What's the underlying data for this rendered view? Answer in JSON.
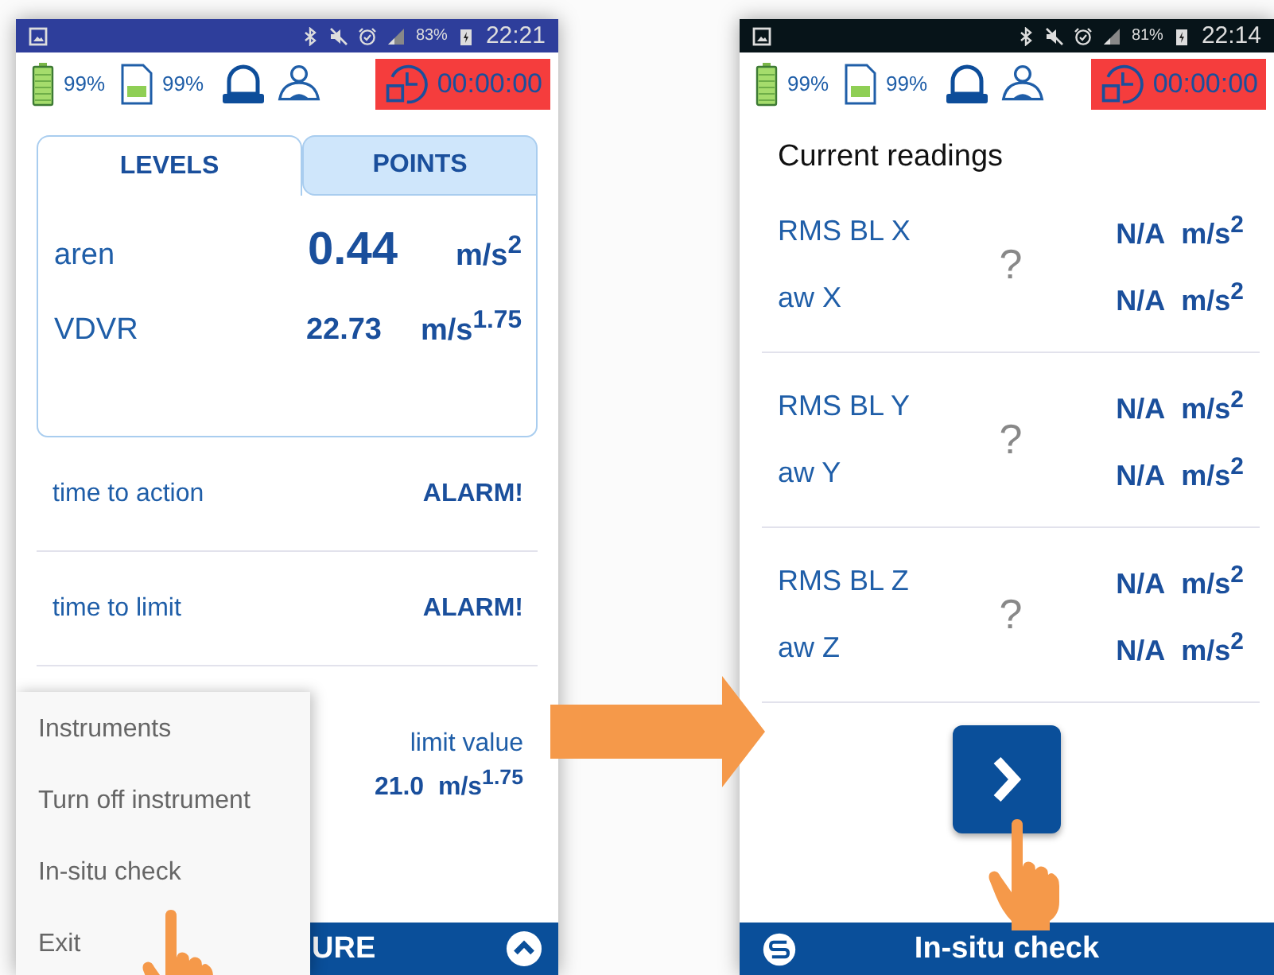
{
  "left_screen": {
    "status_bar": {
      "battery": "83%",
      "time": "22:21"
    },
    "indicators": {
      "battery": "99%",
      "sd_card": "99%",
      "timer": "00:00:00"
    },
    "tabs": [
      {
        "label": "LEVELS",
        "selected": true
      },
      {
        "label": "POINTS",
        "selected": false
      }
    ],
    "levels": [
      {
        "name": "aren",
        "value": "0.44",
        "unit": "m/s$^{2}$",
        "kind": "large"
      },
      {
        "name": "VDVR",
        "value": "22.73",
        "unit": "m/s$^{1.75}$",
        "kind": "normal"
      }
    ],
    "rows": [
      {
        "label": "time to action",
        "value": "ALARM!",
        "kind": "inline"
      },
      {
        "label": "time to limit",
        "value": "ALARM!",
        "kind": "inline"
      },
      {
        "label": "limit value",
        "value": "21.0  m/s$^{1.75}$",
        "kind": "stacked"
      }
    ],
    "menu": [
      "Instruments",
      "Turn off instrument",
      "In-situ check",
      "Exit"
    ],
    "bottom_bar": {
      "title": "URE"
    }
  },
  "right_screen": {
    "status_bar": {
      "battery": "81%",
      "time": "22:14"
    },
    "indicators": {
      "battery": "99%",
      "sd_card": "99%",
      "timer": "00:00:00"
    },
    "heading": "Current readings",
    "groups": [
      {
        "mark": "?",
        "readings": [
          {
            "label": "RMS BL X",
            "value": "N/A",
            "unit": "m/s$^{2}$"
          },
          {
            "label": "aw X",
            "value": "N/A",
            "unit": "m/s$^{2}$"
          }
        ]
      },
      {
        "mark": "?",
        "readings": [
          {
            "label": "RMS BL Y",
            "value": "N/A",
            "unit": "m/s$^{2}$"
          },
          {
            "label": "aw Y",
            "value": "N/A",
            "unit": "m/s$^{2}$"
          }
        ]
      },
      {
        "mark": "?",
        "readings": [
          {
            "label": "RMS BL Z",
            "value": "N/A",
            "unit": "m/s$^{2}$"
          },
          {
            "label": "aw Z",
            "value": "N/A",
            "unit": "m/s$^{2}$"
          }
        ]
      }
    ],
    "bottom_bar": {
      "title": "In-situ check"
    }
  }
}
